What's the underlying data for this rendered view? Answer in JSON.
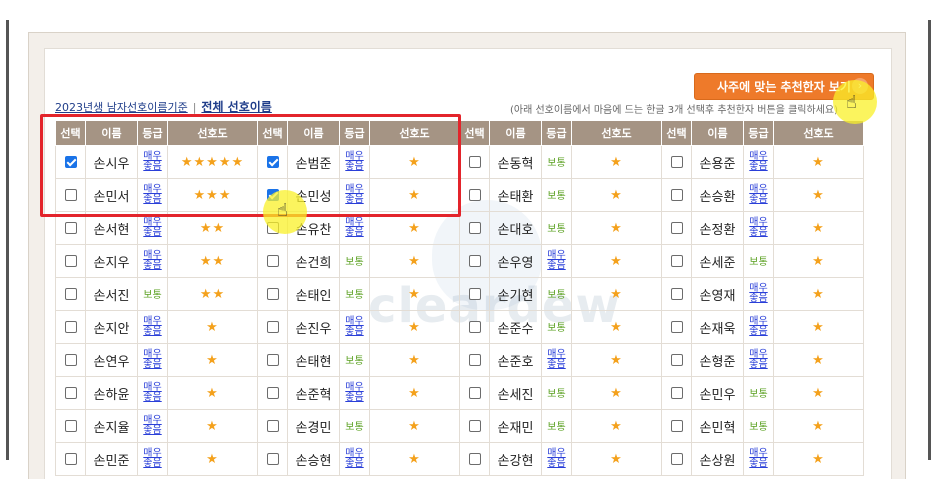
{
  "saju_button": "사주에 맞는 추천한자 보기",
  "chevron_icon": "chevron-right-icon",
  "criteria": {
    "year_text": "2023년생 남자선호이름기준",
    "separator": "|",
    "all_link": "전체 선호이름"
  },
  "note": "(아래 선호이름에서 마음에 드는 한글 3개 선택후 추천한자 버튼을 클릭하세요)",
  "watermark": "cleardew",
  "headers": [
    "선택",
    "이름",
    "등급",
    "선호도"
  ],
  "grades": {
    "good_line1": "매우",
    "good_line2": "좋음",
    "normal": "보통"
  },
  "star_char": "★",
  "columns": [
    [
      {
        "name": "손시우",
        "checked": true,
        "grade": "good",
        "stars": 5
      },
      {
        "name": "손민서",
        "checked": false,
        "grade": "good",
        "stars": 3
      },
      {
        "name": "손서현",
        "checked": false,
        "grade": "good",
        "stars": 2
      },
      {
        "name": "손지우",
        "checked": false,
        "grade": "good",
        "stars": 2
      },
      {
        "name": "손서진",
        "checked": false,
        "grade": "normal",
        "stars": 2
      },
      {
        "name": "손지안",
        "checked": false,
        "grade": "good",
        "stars": 1
      },
      {
        "name": "손연우",
        "checked": false,
        "grade": "good",
        "stars": 1
      },
      {
        "name": "손하윤",
        "checked": false,
        "grade": "good",
        "stars": 1
      },
      {
        "name": "손지율",
        "checked": false,
        "grade": "good",
        "stars": 1
      },
      {
        "name": "손민준",
        "checked": false,
        "grade": "good",
        "stars": 1
      }
    ],
    [
      {
        "name": "손범준",
        "checked": true,
        "grade": "good",
        "stars": 1
      },
      {
        "name": "손민성",
        "checked": true,
        "grade": "good",
        "stars": 1
      },
      {
        "name": "손유찬",
        "checked": false,
        "grade": "good",
        "stars": 1
      },
      {
        "name": "손건희",
        "checked": false,
        "grade": "normal",
        "stars": 1
      },
      {
        "name": "손태인",
        "checked": false,
        "grade": "normal",
        "stars": 1
      },
      {
        "name": "손진우",
        "checked": false,
        "grade": "good",
        "stars": 1
      },
      {
        "name": "손태현",
        "checked": false,
        "grade": "normal",
        "stars": 1
      },
      {
        "name": "손준혁",
        "checked": false,
        "grade": "good",
        "stars": 1
      },
      {
        "name": "손경민",
        "checked": false,
        "grade": "normal",
        "stars": 1
      },
      {
        "name": "손승현",
        "checked": false,
        "grade": "good",
        "stars": 1
      }
    ],
    [
      {
        "name": "손동혁",
        "checked": false,
        "grade": "normal",
        "stars": 1
      },
      {
        "name": "손태환",
        "checked": false,
        "grade": "normal",
        "stars": 1
      },
      {
        "name": "손대호",
        "checked": false,
        "grade": "normal",
        "stars": 1
      },
      {
        "name": "손우영",
        "checked": false,
        "grade": "good",
        "stars": 1
      },
      {
        "name": "손기현",
        "checked": false,
        "grade": "normal",
        "stars": 1
      },
      {
        "name": "손준수",
        "checked": false,
        "grade": "normal",
        "stars": 1
      },
      {
        "name": "손준호",
        "checked": false,
        "grade": "good",
        "stars": 1
      },
      {
        "name": "손세진",
        "checked": false,
        "grade": "normal",
        "stars": 1
      },
      {
        "name": "손재민",
        "checked": false,
        "grade": "normal",
        "stars": 1
      },
      {
        "name": "손강현",
        "checked": false,
        "grade": "good",
        "stars": 1
      }
    ],
    [
      {
        "name": "손용준",
        "checked": false,
        "grade": "good",
        "stars": 1
      },
      {
        "name": "손승환",
        "checked": false,
        "grade": "good",
        "stars": 1
      },
      {
        "name": "손정환",
        "checked": false,
        "grade": "good",
        "stars": 1
      },
      {
        "name": "손세준",
        "checked": false,
        "grade": "normal",
        "stars": 1
      },
      {
        "name": "손영재",
        "checked": false,
        "grade": "good",
        "stars": 1
      },
      {
        "name": "손재욱",
        "checked": false,
        "grade": "good",
        "stars": 1
      },
      {
        "name": "손형준",
        "checked": false,
        "grade": "good",
        "stars": 1
      },
      {
        "name": "손민우",
        "checked": false,
        "grade": "normal",
        "stars": 1
      },
      {
        "name": "손민혁",
        "checked": false,
        "grade": "normal",
        "stars": 1
      },
      {
        "name": "손상원",
        "checked": false,
        "grade": "good",
        "stars": 1
      }
    ]
  ]
}
